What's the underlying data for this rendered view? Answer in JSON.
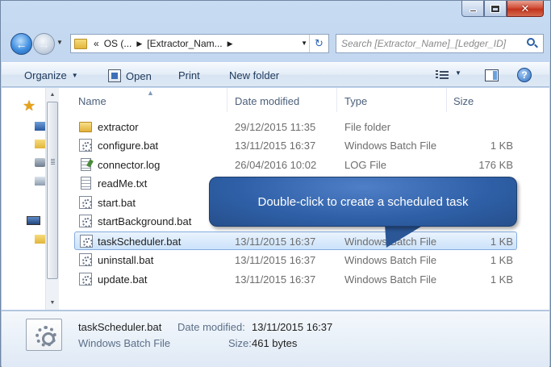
{
  "window": {
    "address": {
      "segments": [
        "«",
        "OS (...",
        "[Extractor_Nam..."
      ]
    },
    "search": {
      "placeholder": "Search [Extractor_Name]_[Ledger_ID]"
    }
  },
  "toolbar": {
    "organize": "Organize",
    "open": "Open",
    "print": "Print",
    "new_folder": "New folder"
  },
  "columns": {
    "name": "Name",
    "date": "Date modified",
    "type": "Type",
    "size": "Size"
  },
  "files": [
    {
      "name": "extractor",
      "date": "29/12/2015 11:35",
      "type": "File folder",
      "size": "",
      "icon": "folder-icon"
    },
    {
      "name": "configure.bat",
      "date": "13/11/2015 16:37",
      "type": "Windows Batch File",
      "size": "1 KB",
      "icon": "batch-file-icon"
    },
    {
      "name": "connector.log",
      "date": "26/04/2016 10:02",
      "type": "LOG File",
      "size": "176 KB",
      "icon": "log-file-icon"
    },
    {
      "name": "readMe.txt",
      "date": "",
      "type": "",
      "size": "KB",
      "icon": "text-file-icon"
    },
    {
      "name": "start.bat",
      "date": "",
      "type": "",
      "size": "KB",
      "icon": "batch-file-icon"
    },
    {
      "name": "startBackground.bat",
      "date": "",
      "type": "",
      "size": "KB",
      "icon": "batch-file-icon"
    },
    {
      "name": "taskScheduler.bat",
      "date": "13/11/2015 16:37",
      "type": "Windows Batch File",
      "size": "1 KB",
      "icon": "batch-file-icon",
      "selected": true
    },
    {
      "name": "uninstall.bat",
      "date": "13/11/2015 16:37",
      "type": "Windows Batch File",
      "size": "1 KB",
      "icon": "batch-file-icon"
    },
    {
      "name": "update.bat",
      "date": "13/11/2015 16:37",
      "type": "Windows Batch File",
      "size": "1 KB",
      "icon": "batch-file-icon"
    }
  ],
  "callout": {
    "text": "Double-click to create a scheduled  task"
  },
  "details": {
    "name": "taskScheduler.bat",
    "type": "Windows Batch File",
    "date_label": "Date modified:",
    "date_value": "13/11/2015 16:37",
    "size_label": "Size:",
    "size_value": "461 bytes"
  },
  "colors": {
    "selection": "#cbe2fa",
    "callout": "#2e5fa6",
    "close_button": "#c2341c"
  }
}
